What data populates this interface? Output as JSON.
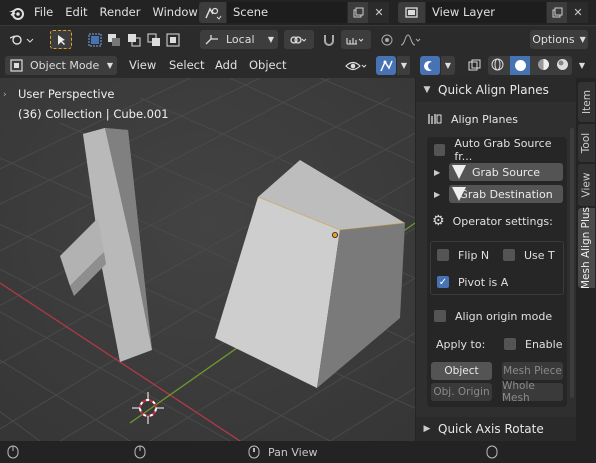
{
  "topbar": {
    "menus": [
      "File",
      "Edit",
      "Render",
      "Window"
    ],
    "scene_name": "Scene",
    "view_layer_name": "View Layer"
  },
  "toolbar": {
    "orientation": "Local",
    "options_label": "Options"
  },
  "header": {
    "mode": "Object Mode",
    "menus": [
      "View",
      "Select",
      "Add",
      "Object"
    ]
  },
  "viewport": {
    "perspective_label": "User Perspective",
    "object_info": "(36) Collection | Cube.001"
  },
  "npanel": {
    "panel_title": "Quick Align Planes",
    "subpanel_title": "Align Planes",
    "auto_grab": "Auto Grab Source fr...",
    "auto_grab_checked": false,
    "grab_source": "Grab Source",
    "grab_destination": "Grab Destination",
    "operator_settings": "Operator settings:",
    "flip_n": "Flip N",
    "flip_n_checked": false,
    "use_t": "Use T",
    "use_t_checked": false,
    "pivot_is_a": "Pivot is A",
    "pivot_is_a_checked": true,
    "align_origin_mode": "Align origin mode",
    "align_origin_checked": false,
    "apply_to": "Apply to:",
    "enable": "Enable",
    "enable_checked": false,
    "object_btn": "Object",
    "mesh_piece_btn": "Mesh Piece",
    "obj_origin_btn": "Obj. Origin",
    "whole_mesh_btn": "Whole Mesh",
    "next_panel_title": "Quick Axis Rotate"
  },
  "vtabs": [
    "Item",
    "Tool",
    "View",
    "Mesh Align Plus"
  ],
  "status": {
    "action": "Pan View"
  },
  "colors": {
    "accent_blue": "#4772b3",
    "selection_orange": "#e8a020",
    "grid_x_axis": "#b3384a",
    "grid_y_axis": "#6e9a2a"
  }
}
